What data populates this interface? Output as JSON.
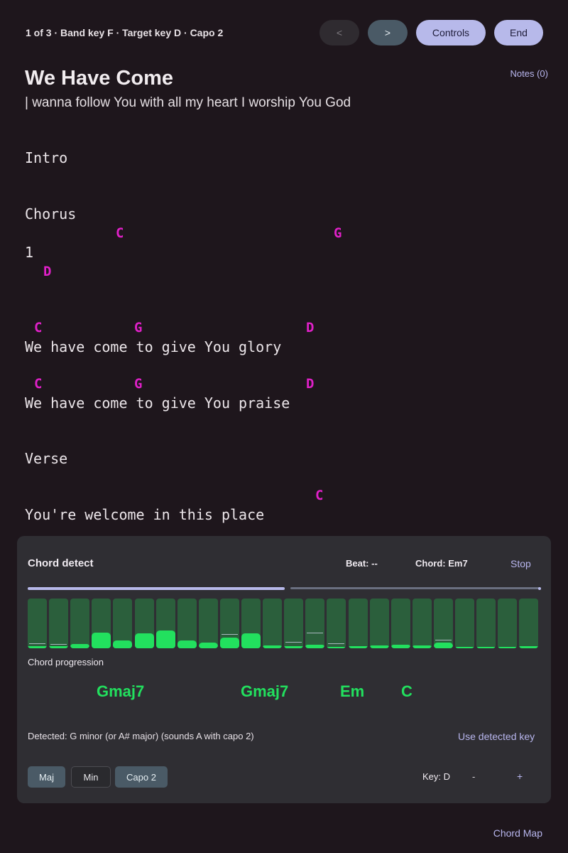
{
  "header": {
    "status": "1 of 3 · Band key F · Target key D · Capo 2",
    "prev_label": "<",
    "next_label": ">",
    "controls_label": "Controls",
    "end_label": "End",
    "notes_label": "Notes (0)"
  },
  "song": {
    "title": "We Have Come",
    "subtitle": "| wanna follow You with all my heart I worship You God",
    "sections": {
      "intro": "Intro",
      "chorus": "Chorus",
      "verse": "Verse"
    },
    "chorus_marker": "1",
    "chords": {
      "c1": "C",
      "g1": "G",
      "d1": "D",
      "c2": "C",
      "g2": "G",
      "d2": "D",
      "c3": "C",
      "g3": "G",
      "d3": "D",
      "c4": "C"
    },
    "lyrics": {
      "line1": "We have come to give You glory",
      "line2": "We have come to give You praise",
      "line3": "You're welcome in this place"
    }
  },
  "chord_detect": {
    "title": "Chord detect",
    "beat_label": "Beat: --",
    "chord_label": "Chord: Em7",
    "stop_label": "Stop",
    "progress_fraction": 0.5,
    "spectrum_levels": [
      0.04,
      0.04,
      0.08,
      0.32,
      0.16,
      0.3,
      0.36,
      0.15,
      0.12,
      0.22,
      0.3,
      0.06,
      0.04,
      0.07,
      0.03,
      0.04,
      0.06,
      0.07,
      0.05,
      0.12,
      0.02,
      0.03,
      0.03,
      0.04
    ],
    "spectrum_peaks": [
      0.08,
      0.07,
      null,
      null,
      null,
      null,
      null,
      null,
      null,
      0.27,
      null,
      null,
      0.12,
      0.3,
      0.08,
      null,
      null,
      null,
      null,
      0.16,
      null,
      null,
      null,
      null
    ],
    "progression_label": "Chord progression",
    "progression": [
      "Gmaj7",
      "Gmaj7",
      "Em",
      "C"
    ],
    "detected_text": "Detected: G minor (or A# major) (sounds A with capo 2)",
    "use_detected_label": "Use detected key",
    "maj_label": "Maj",
    "min_label": "Min",
    "capo_label": "Capo 2",
    "key_label": "Key: D",
    "minus_label": "-",
    "plus_label": "+"
  },
  "footer": {
    "chord_map_label": "Chord Map"
  },
  "colors": {
    "background": "#1e161c",
    "chord": "#e020c8",
    "detect_green": "#22e05e",
    "accent": "#b7b9ea"
  }
}
